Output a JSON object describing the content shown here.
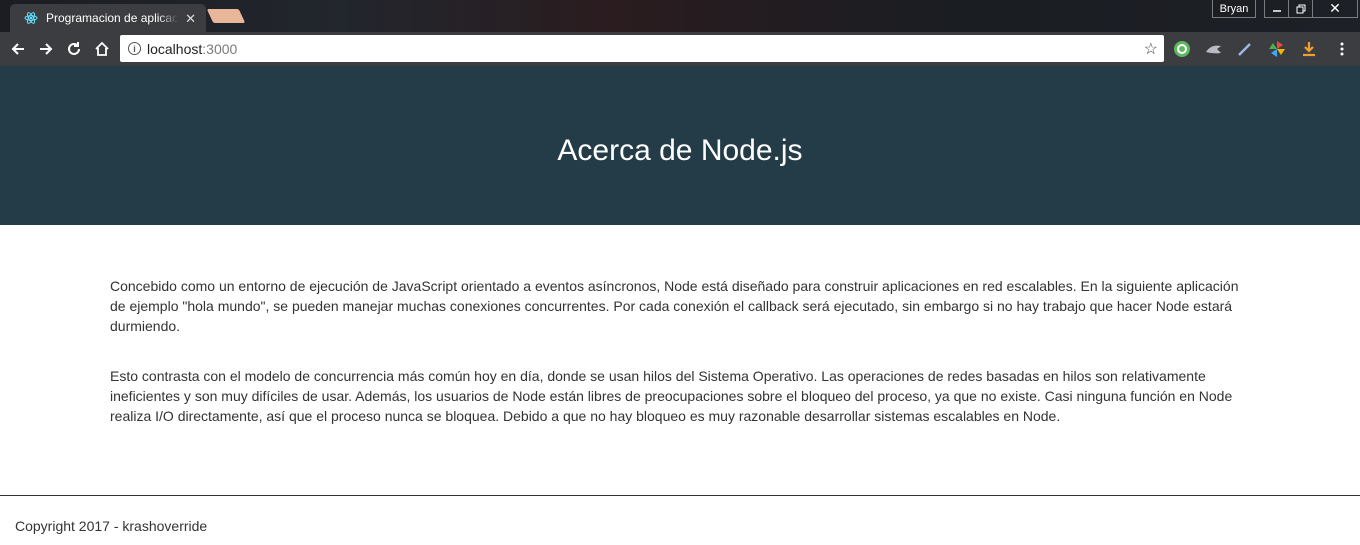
{
  "browser": {
    "tab": {
      "title": "Programacion de aplicaciones",
      "favicon": "react-atom-icon"
    },
    "profile_name": "Bryan",
    "address": {
      "host": "localhost",
      "port": ":3000"
    },
    "colors": {
      "tabbar": "#1b1d22",
      "toolbar": "#3c3d40",
      "new_tab": "#e8b79a"
    }
  },
  "page": {
    "hero_title": "Acerca de Node.js",
    "paragraphs": [
      "Concebido como un entorno de ejecución de JavaScript orientado a eventos asíncronos, Node está diseñado para construir aplicaciones en red escalables. En la siguiente aplicación de ejemplo \"hola mundo\", se pueden manejar muchas conexiones concurrentes. Por cada conexión el callback será ejecutado, sin embargo si no hay trabajo que hacer Node estará durmiendo.",
      "Esto contrasta con el modelo de concurrencia más común hoy en día, donde se usan hilos del Sistema Operativo. Las operaciones de redes basadas en hilos son relativamente ineficientes y son muy difíciles de usar. Además, los usuarios de Node están libres de preocupaciones sobre el bloqueo del proceso, ya que no existe. Casi ninguna función en Node realiza I/O directamente, así que el proceso nunca se bloquea. Debido a que no hay bloqueo es muy razonable desarrollar sistemas escalables en Node."
    ],
    "footer": "Copyright 2017 - krashoverride",
    "colors": {
      "hero_bg": "#243c48",
      "text": "#333333"
    }
  }
}
